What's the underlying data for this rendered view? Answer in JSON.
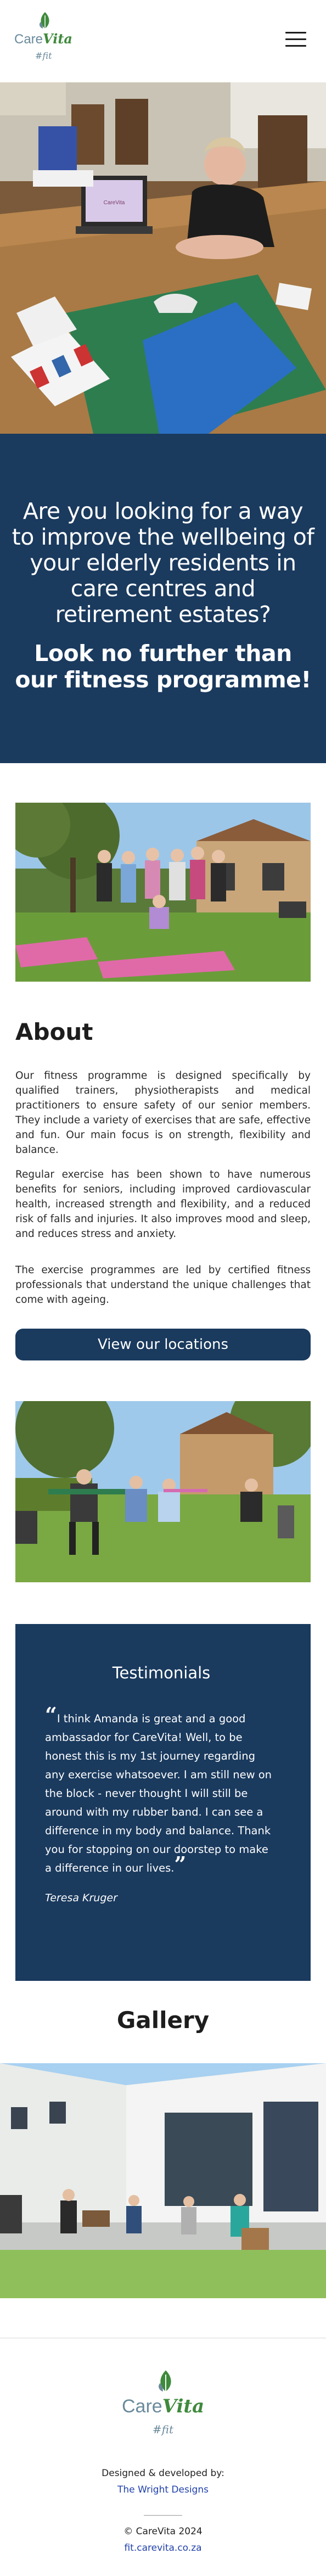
{
  "header": {
    "logo": {
      "care": "Care",
      "vita": "Vita",
      "fit": "#fit"
    },
    "menu_label": ""
  },
  "hero": {
    "photo_paper": "CareVita",
    "heading": "Are you looking for a way to improve the wellbeing of your elderly residents in care centres and retirement estates?",
    "subheading": "Look no further than our fitness programme!"
  },
  "about": {
    "title": "About",
    "paragraphs": [
      "Our fitness programme is designed specifically by qualified trainers, physiotherapists and medical practitioners to ensure safety of our senior members. They include a variety of exercises that are safe, effective and fun. Our main focus is on strength, flexibility and balance.",
      "Regular exercise has been shown to have numerous benefits for seniors, including improved cardiovascular health, increased strength and flexibility, and a reduced risk of falls and injuries. It also improves mood and sleep, and reduces stress and anxiety.",
      "The exercise programmes are led by certified fitness professionals that understand the unique challenges that come with ageing."
    ],
    "button_label": "View our locations"
  },
  "testimonials": {
    "title": "Testimonials",
    "quote": "I think Amanda is great and a good ambassador for CareVita! Well, to be honest this is my 1st journey regarding any exercise whatsoever. I am still new on the block - never thought I will still be around with my rubber band. I can see a difference in my body and balance. Thank you for stopping on our doorstep to make a difference in our lives.",
    "author": "Teresa Kruger",
    "open_mark": "“",
    "close_mark": "”"
  },
  "gallery": {
    "title": "Gallery"
  },
  "footer": {
    "logo": {
      "care": "Care",
      "vita": "Vita",
      "fit": "#fit"
    },
    "designed_by": "Designed & developed by:",
    "designer": "The Wright Designs",
    "copyright": "© CareVita 2024",
    "site": "fit.carevita.co.za"
  },
  "colors": {
    "brand_navy": "#1a3a5e",
    "brand_green": "#3f8a3c",
    "brand_grey_blue": "#6a8a9b",
    "link_blue": "#1f3faa"
  }
}
